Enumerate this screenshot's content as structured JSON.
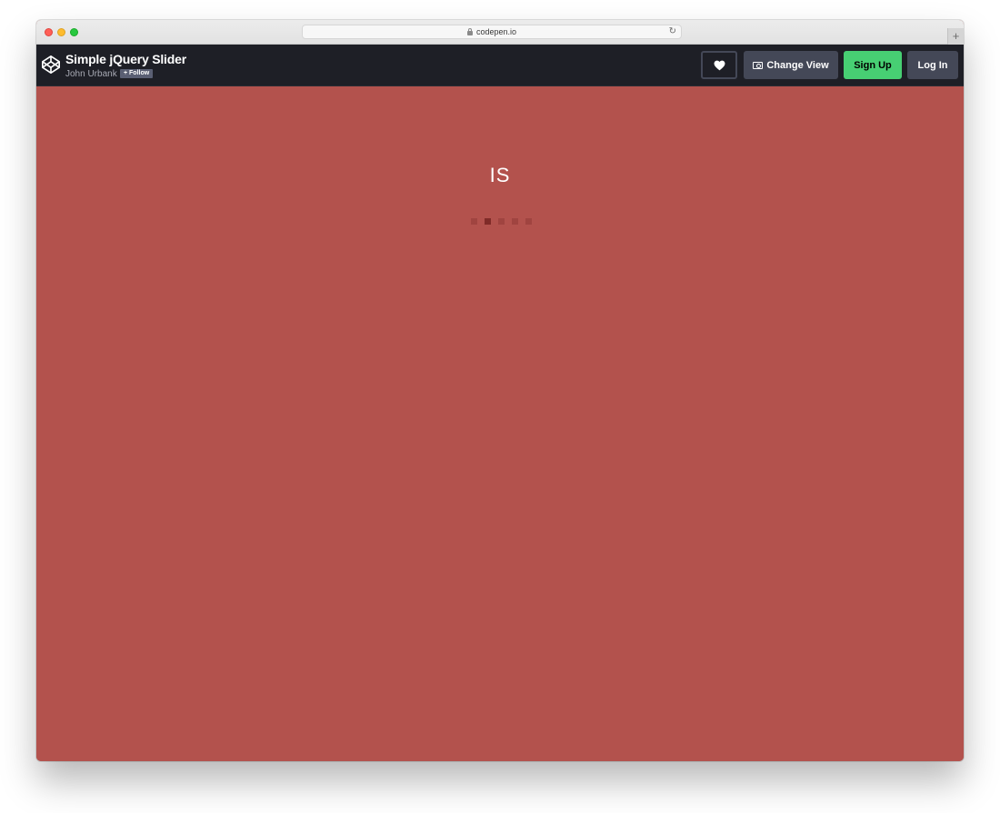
{
  "browser": {
    "url": "codepen.io",
    "new_tab_label": "+"
  },
  "header": {
    "title": "Simple jQuery Slider",
    "author": "John Urbank",
    "follow_label": "+ Follow",
    "change_view_label": "Change View",
    "signup_label": "Sign Up",
    "login_label": "Log In"
  },
  "slider": {
    "current_text": "IS",
    "dot_count": 5,
    "active_dot_index": 1
  },
  "colors": {
    "slide_background": "#b3524d",
    "header_background": "#1e1f26",
    "signup_green": "#47cf73",
    "button_gray": "#444857"
  },
  "icons": {
    "logo": "codepen-logo-icon",
    "heart": "heart-icon",
    "view": "change-view-icon",
    "lock": "lock-icon",
    "reload": "reload-icon"
  }
}
